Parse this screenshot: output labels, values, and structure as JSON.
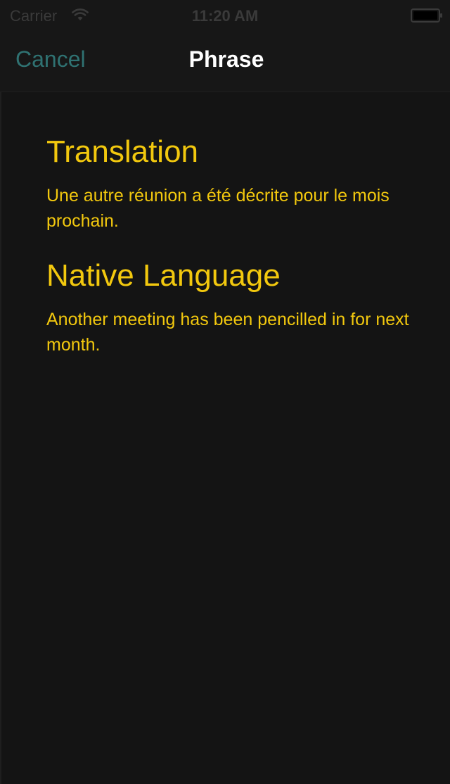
{
  "status_bar": {
    "carrier": "Carrier",
    "time": "11:20 AM",
    "wifi_icon": "wifi-icon",
    "battery_icon": "battery-icon"
  },
  "nav": {
    "cancel_label": "Cancel",
    "title": "Phrase"
  },
  "sections": [
    {
      "heading": "Translation",
      "text": "Une autre réunion a été décrite pour le mois prochain."
    },
    {
      "heading": "Native Language",
      "text": "Another meeting has been pencilled in for next month."
    }
  ],
  "colors": {
    "background": "#141414",
    "accent": "#f2c80e",
    "cancel": "#2f7272",
    "title": "#ffffff"
  }
}
